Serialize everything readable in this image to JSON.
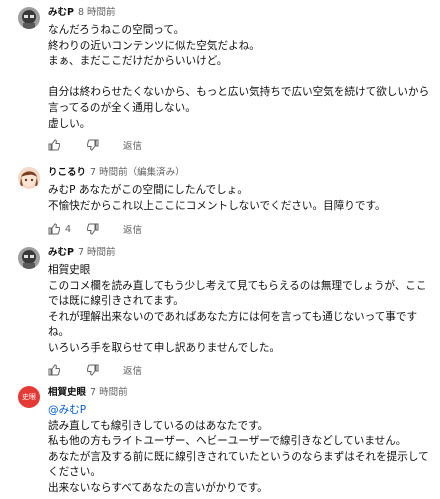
{
  "comments": [
    {
      "author": "みむP",
      "time": "8 時間前",
      "lines": [
        "なんだろうねこの空間って。",
        "終わりの近いコンテンツに似た空気だよね。",
        "まぁ、まだここだけだからいいけど。",
        "",
        "自分は終わらせたくないから、もっと広い気持ちで広い空気を続けて欲しいから",
        "言ってるのが全く通用しない。",
        "虚しい。"
      ],
      "likes": "",
      "reply": "返信"
    },
    {
      "author": "りこるり",
      "time": "7 時間前",
      "edited": "（編集済み）",
      "lines": [
        "みむP あなたがこの空間にしたんでしょ。",
        "不愉快だからこれ以上ここにコメントしないでください。目障りです。"
      ],
      "likes": "4",
      "reply": "返信"
    },
    {
      "author": "みむP",
      "time": "7 時間前",
      "lines": [
        "相賀史眼",
        "このコメ欄を読み直してもう少し考えて見てもらえるのは無理でしょうが、ここ",
        "では既に線引きされてます。",
        "それが理解出来ないのであればあなた方には何を言っても通じないって事です",
        "ね。",
        "いろいろ手を取らせて申し訳ありませんでした。"
      ],
      "likes": "",
      "reply": "返信"
    },
    {
      "author": "相賀史眼",
      "time": "7 時間前",
      "avatar_text": "史眼",
      "mention": "@みむP",
      "lines": [
        "読み直しても線引きしているのはあなたです。",
        "私も他の方もライトユーザー、ヘビーユーザーで線引きなどしていません。",
        "あなたが言及する前に既に線引きされていたというのならまずはそれを提示して",
        "ください。",
        "出来ないならすべてあなたの言いがかりです。"
      ]
    }
  ],
  "colors": {
    "time": "#606060",
    "mention": "#065fd4",
    "avatar_red": "#e53935"
  }
}
